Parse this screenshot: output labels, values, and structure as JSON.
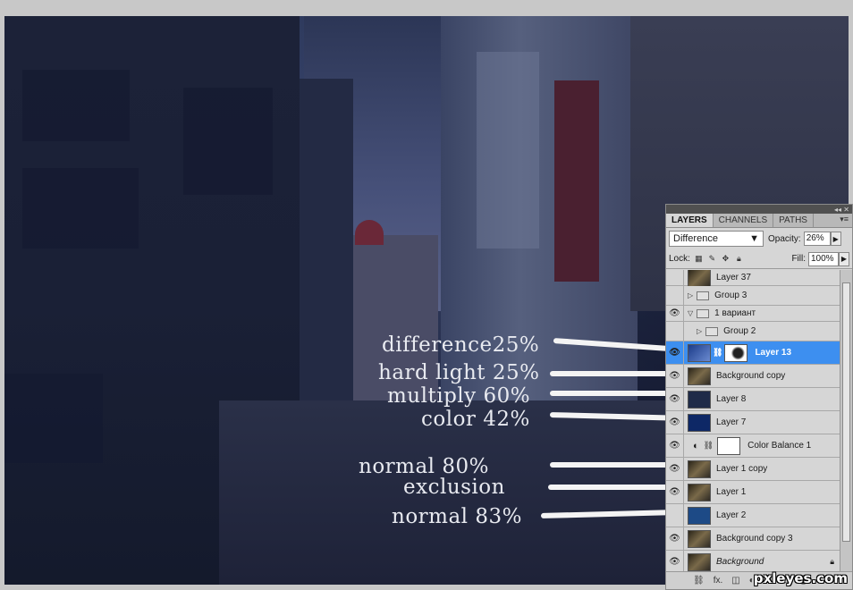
{
  "callouts": [
    {
      "text": "difference25%"
    },
    {
      "text": "hard light 25%"
    },
    {
      "text": "multiply 60%"
    },
    {
      "text": "color 42%"
    },
    {
      "text": "normal 80%"
    },
    {
      "text": "exclusion"
    },
    {
      "text": "normal 83%"
    }
  ],
  "panel": {
    "tabs": [
      "LAYERS",
      "CHANNELS",
      "PATHS"
    ],
    "blend_mode": "Difference",
    "opacity_label": "Opacity:",
    "opacity_value": "26%",
    "lock_label": "Lock:",
    "fill_label": "Fill:",
    "fill_value": "100%",
    "layers": [
      {
        "name": "Layer 37",
        "visible": false,
        "kind": "image"
      },
      {
        "name": "Group 3",
        "visible": false,
        "kind": "group",
        "expanded": false
      },
      {
        "name": "1 вариант",
        "visible": true,
        "kind": "group",
        "expanded": true
      },
      {
        "name": "Group 2",
        "visible": false,
        "kind": "group",
        "expanded": false
      },
      {
        "name": "Layer 13",
        "visible": true,
        "kind": "masked",
        "selected": true
      },
      {
        "name": "Background copy",
        "visible": true,
        "kind": "image"
      },
      {
        "name": "Layer 8",
        "visible": true,
        "kind": "fill",
        "color": "#1f2b48"
      },
      {
        "name": "Layer 7",
        "visible": true,
        "kind": "fill",
        "color": "#0e2866"
      },
      {
        "name": "Color Balance 1",
        "visible": true,
        "kind": "adjustment"
      },
      {
        "name": "Layer 1 copy",
        "visible": true,
        "kind": "image"
      },
      {
        "name": "Layer 1",
        "visible": true,
        "kind": "image"
      },
      {
        "name": "Layer 2",
        "visible": false,
        "kind": "fill",
        "color": "#1d4a86"
      },
      {
        "name": "Background copy 3",
        "visible": true,
        "kind": "image"
      },
      {
        "name": "Background",
        "visible": true,
        "kind": "image",
        "locked": true
      }
    ],
    "bottom_icons": [
      "link-icon",
      "fx-icon",
      "mask-icon",
      "adjustment-icon",
      "folder-icon",
      "new-layer-icon",
      "trash-icon"
    ]
  },
  "watermark": "pxleyes.com",
  "colors": {
    "selected": "#3d8ff0",
    "panel_bg": "#d6d6d6"
  }
}
